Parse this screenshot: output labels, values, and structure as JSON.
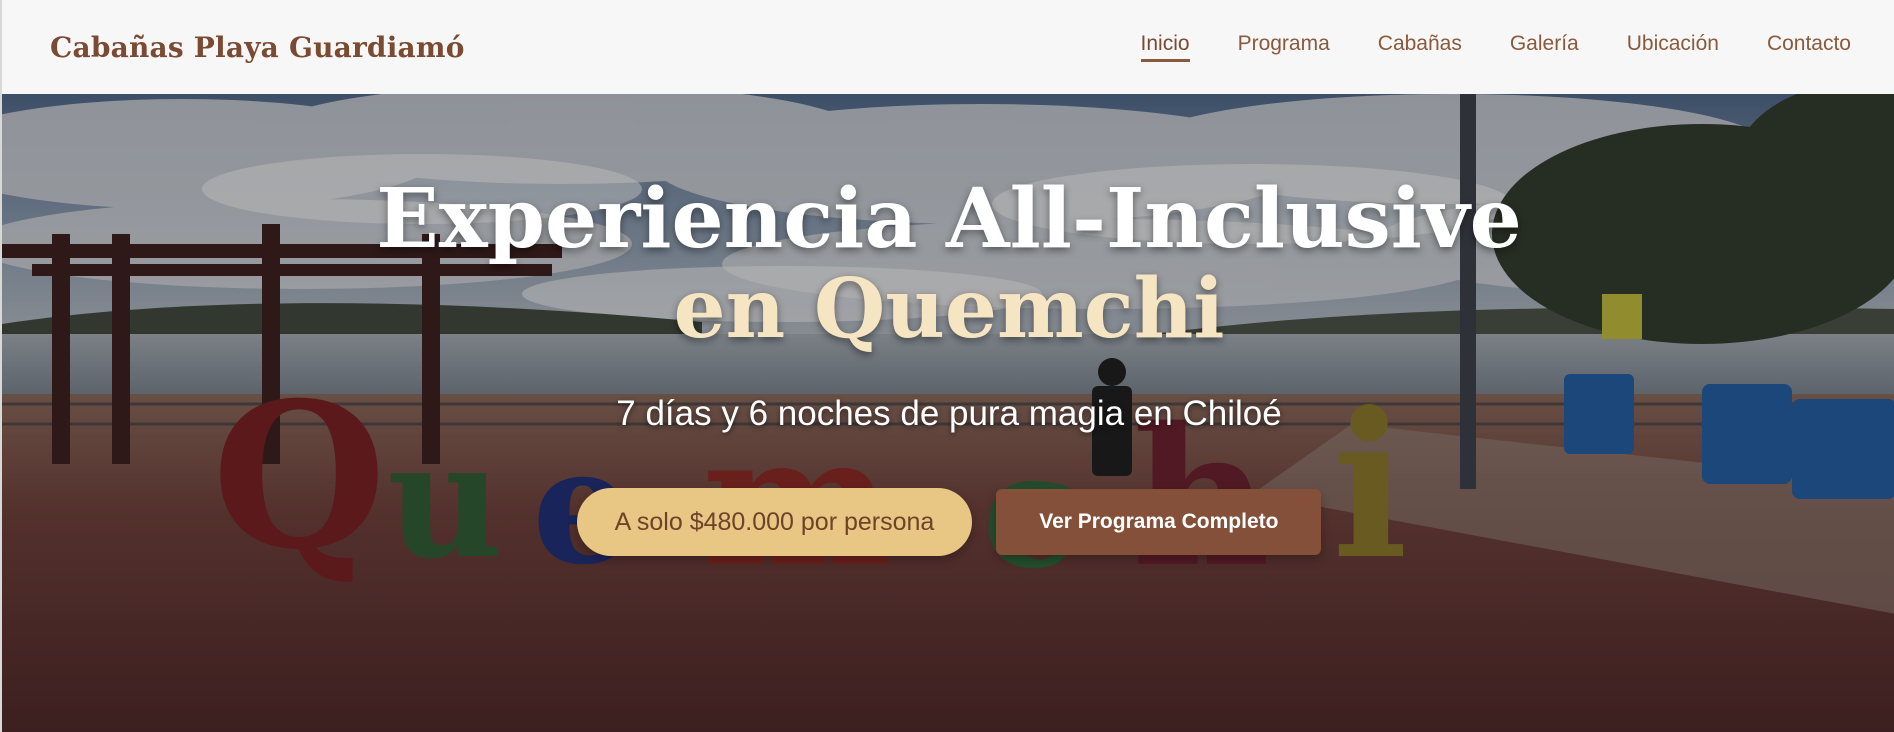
{
  "header": {
    "brand": "Cabañas Playa Guardiamó",
    "nav": [
      {
        "label": "Inicio",
        "active": true
      },
      {
        "label": "Programa",
        "active": false
      },
      {
        "label": "Cabañas",
        "active": false
      },
      {
        "label": "Galería",
        "active": false
      },
      {
        "label": "Ubicación",
        "active": false
      },
      {
        "label": "Contacto",
        "active": false
      }
    ]
  },
  "hero": {
    "title_line1": "Experiencia All-Inclusive",
    "title_line2": "en Quemchi",
    "subtitle": "7 días y 6 noches de pura magia en Chiloé",
    "price_button": "A solo $480.000 por persona",
    "program_button": "Ver Programa Completo",
    "sign_text": "Quemchi"
  },
  "colors": {
    "brand": "#7b4a33",
    "accent_gold": "#e8c683",
    "button_brown": "#84503a",
    "title_cream": "#f6e5c2"
  }
}
